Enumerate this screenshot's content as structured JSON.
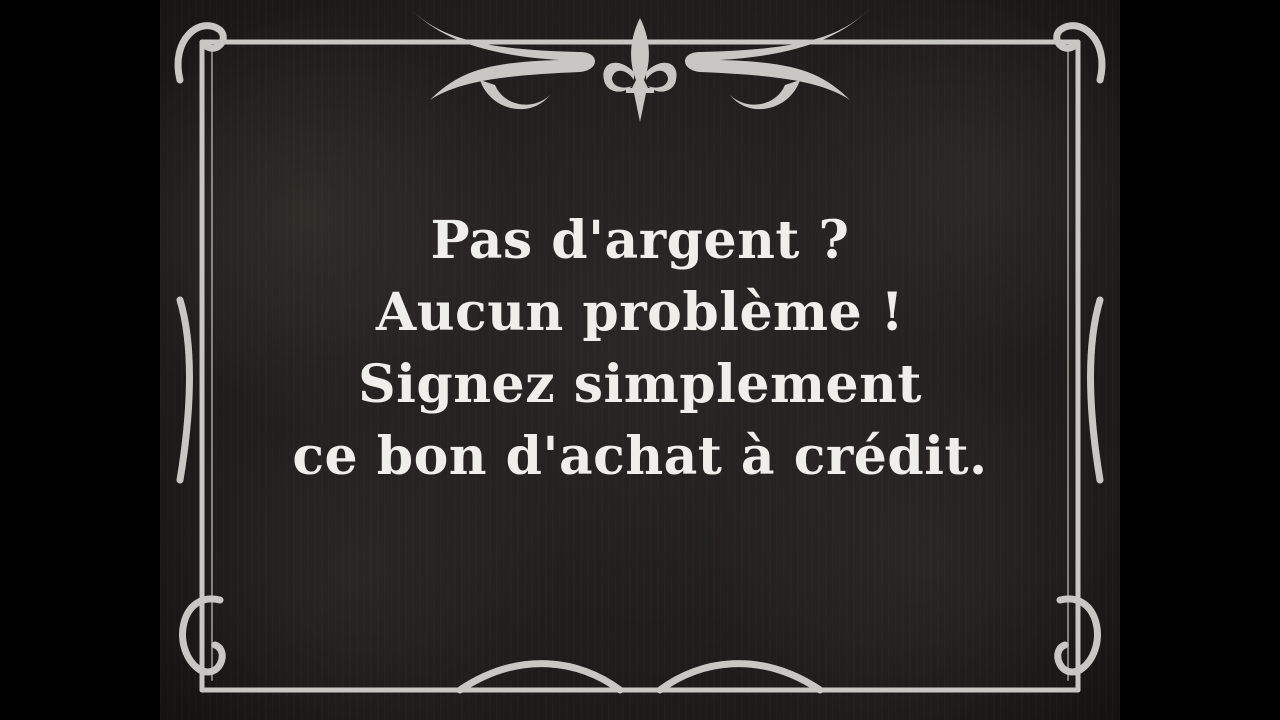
{
  "card": {
    "lines": [
      "Pas d'argent ?",
      "Aucun problème !",
      "Signez simplement",
      "ce bon d'achat à crédit."
    ]
  },
  "colors": {
    "letterbox": "#000000",
    "card_background": "#221f1f",
    "text": "#efeeeb",
    "ornament": "#c9c7c3"
  },
  "ornaments": {
    "top_center": "fleur-de-lis-icon",
    "corners": "scroll-flourish-icon"
  }
}
